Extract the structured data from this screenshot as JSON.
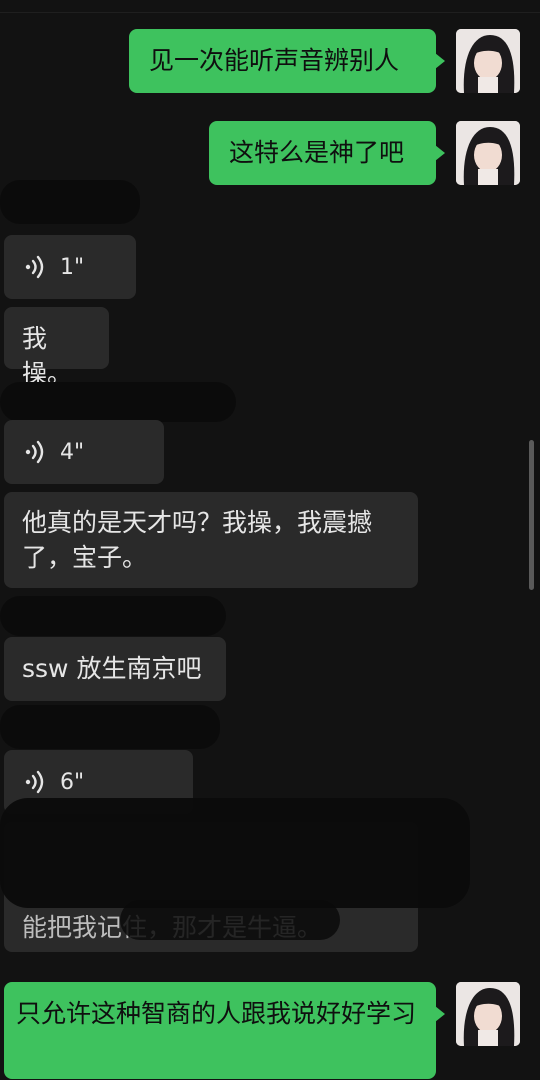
{
  "messages": {
    "m1": {
      "text": "见一次能听声音辨别人"
    },
    "m2": {
      "text": "这特么是神了吧"
    },
    "m3": {
      "duration": "1\""
    },
    "m4": {
      "text": "我操。"
    },
    "m5": {
      "duration": "4\""
    },
    "m6": {
      "text": "他真的是天才吗？我操，我震撼了，宝子。"
    },
    "m7": {
      "text": "ssw 放生南京吧"
    },
    "m8": {
      "duration": "6\""
    },
    "m9": {
      "text": "能把我记住，那才是牛逼。"
    },
    "m10": {
      "text": "只允许这种智商的人跟我说好好学习"
    }
  },
  "colors": {
    "background": "#121212",
    "outgoing_bubble": "#3ec25e",
    "incoming_bubble": "#2a2a2a"
  },
  "icons": {
    "voice": "voice-wave-icon",
    "avatar": "user-avatar-photo"
  }
}
